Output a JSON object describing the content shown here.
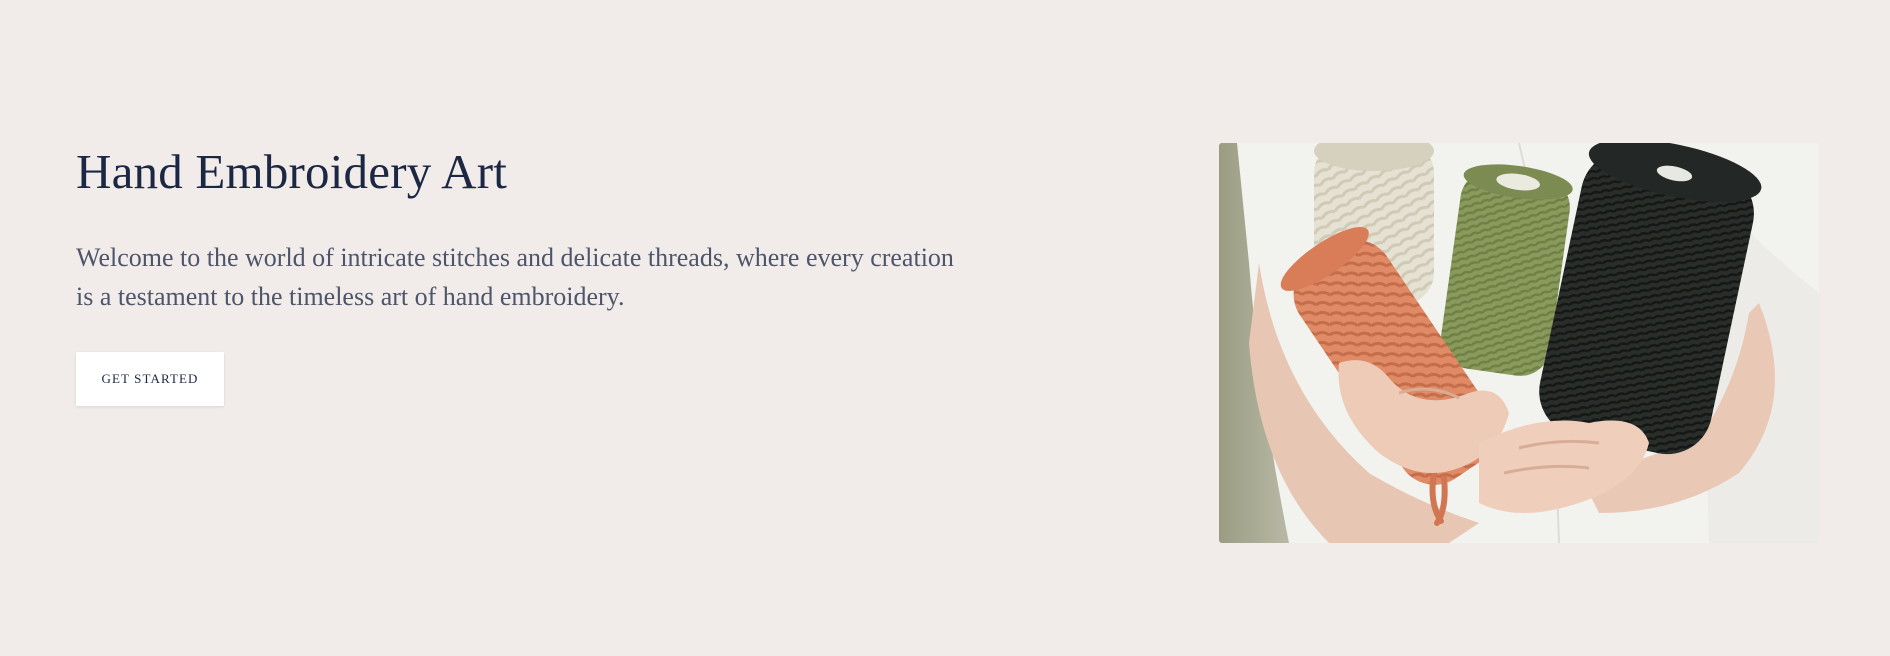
{
  "hero": {
    "title": "Hand Embroidery Art",
    "description": "Welcome to the world of intricate stitches and delicate threads, where every creation is a testament to the timeless art of hand embroidery.",
    "cta_label": "GET STARTED",
    "image_subject": "hands holding spools of cream, orange, green and black macramé cord"
  },
  "colors": {
    "background": "#f1ecea",
    "title": "#1b2743",
    "body_text": "#4d556a",
    "button_bg": "#ffffff"
  }
}
